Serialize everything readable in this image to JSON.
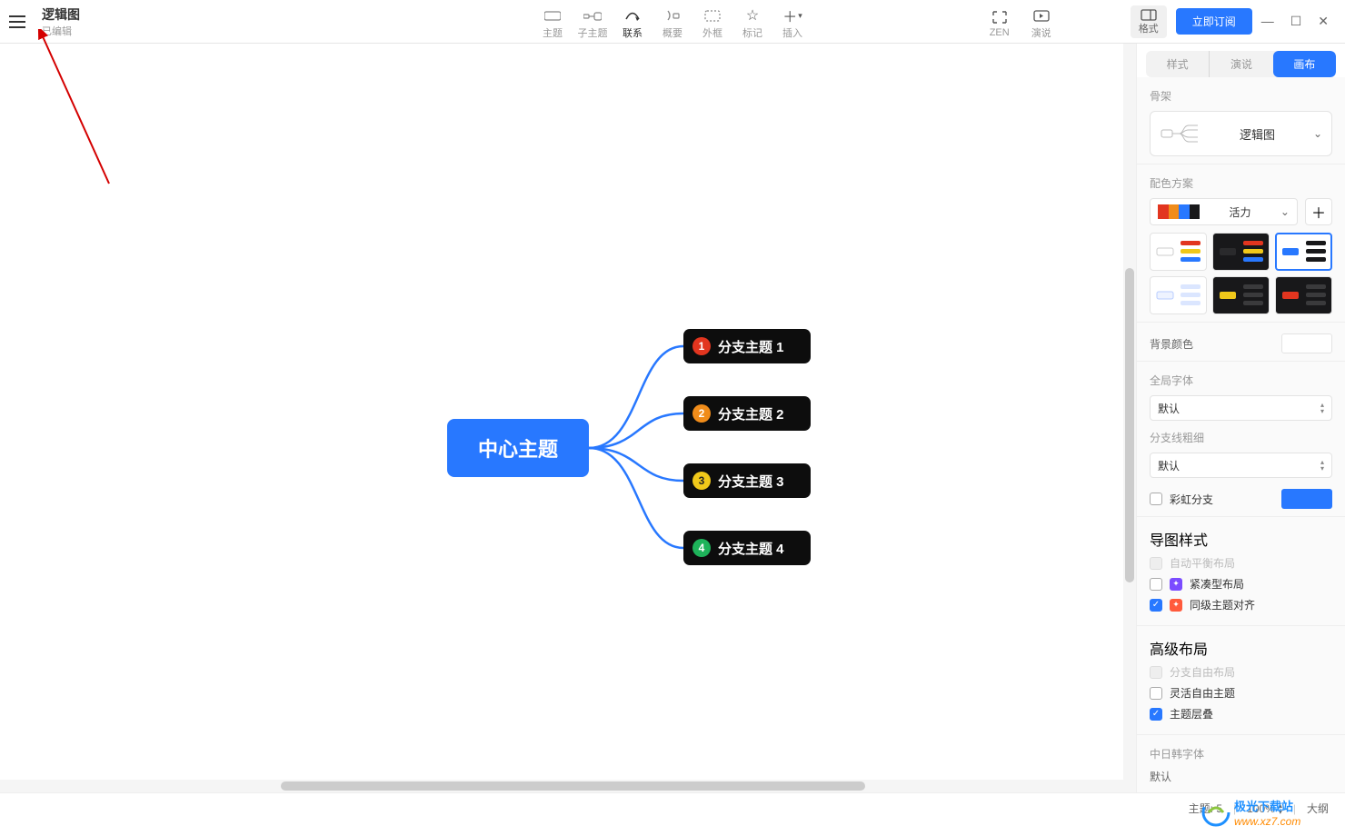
{
  "header": {
    "title": "逻辑图",
    "subtitle": "已编辑"
  },
  "toolbar": {
    "theme": "主题",
    "subtopic": "子主题",
    "relation": "联系",
    "summary": "概要",
    "boundary": "外框",
    "marker": "标记",
    "insert": "插入",
    "zen": "ZEN",
    "pitch": "演说",
    "format": "格式"
  },
  "subscribe": "立即订阅",
  "panel": {
    "tab_style": "样式",
    "tab_pitch": "演说",
    "tab_canvas": "画布",
    "skeleton_title": "骨架",
    "skeleton_value": "逻辑图",
    "color_scheme_title": "配色方案",
    "color_scheme_value": "活力",
    "bg_color_label": "背景颜色",
    "global_font_label": "全局字体",
    "global_font_value": "默认",
    "branch_width_label": "分支线粗细",
    "branch_width_value": "默认",
    "rainbow_label": "彩虹分支",
    "map_style_title": "导图样式",
    "auto_balance": "自动平衡布局",
    "compact": "紧凑型布局",
    "same_level_align": "同级主题对齐",
    "advanced_title": "高级布局",
    "free_branch": "分支自由布局",
    "free_topic": "灵活自由主题",
    "topic_stack": "主题层叠",
    "cjk_font_label": "中日韩字体",
    "cjk_font_value": "默认"
  },
  "mindmap": {
    "center": "中心主题",
    "b1": "分支主题 1",
    "b2": "分支主题 2",
    "b3": "分支主题 3",
    "b4": "分支主题 4"
  },
  "status": {
    "topics_label": "主题:",
    "topics_count": "5",
    "zoom": "100%",
    "outline": "大纲"
  },
  "colors": {
    "accent": "#2878ff",
    "red": "#e2351f",
    "orange": "#f08c1a",
    "yellow": "#f0c81a",
    "green": "#1eb35a"
  },
  "watermark": {
    "brand": "极光下载站",
    "url": "www.xz7.com"
  }
}
